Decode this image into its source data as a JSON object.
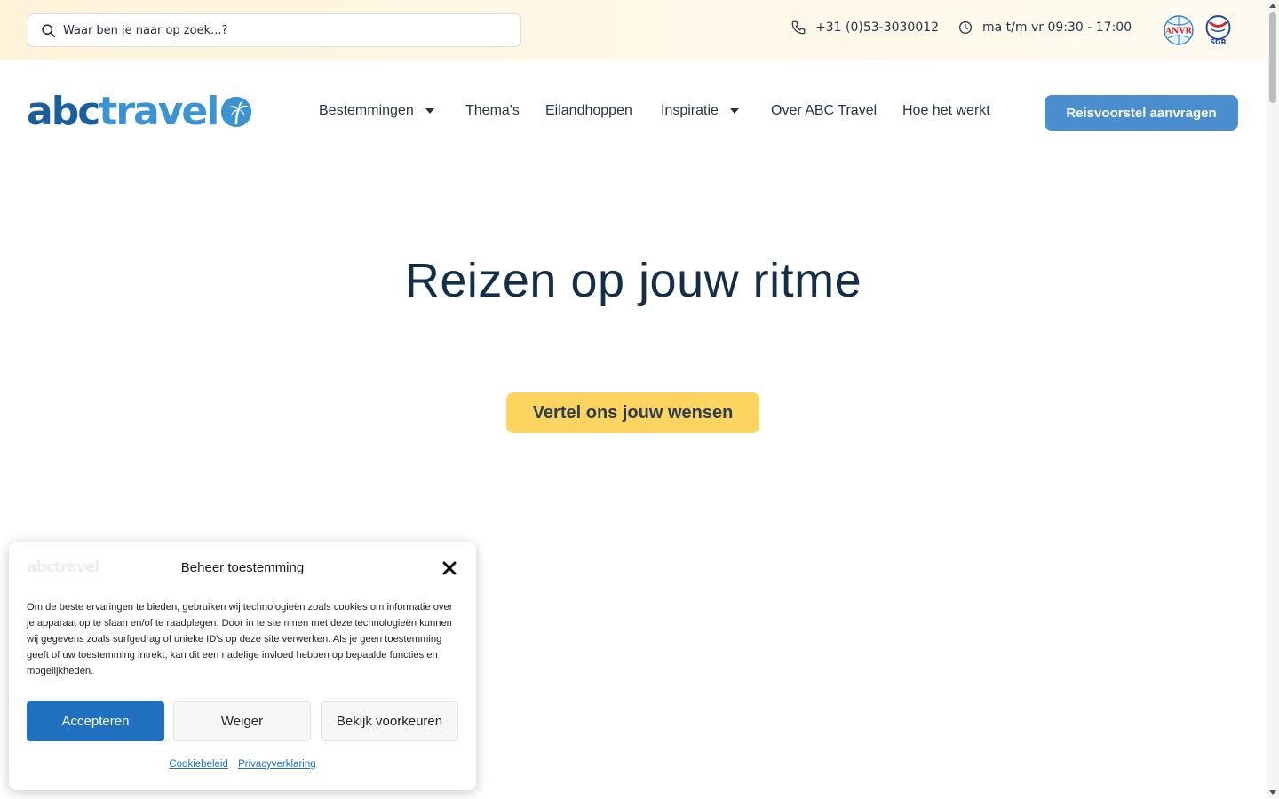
{
  "topbar": {
    "search_placeholder": "Waar ben je naar op zoek...?",
    "phone": "+31 (0)53-3030012",
    "hours": "ma t/m vr 09:30 - 17:00",
    "badge_anvr": "ANVR",
    "badge_sgr": "SGR"
  },
  "logo": {
    "part1": "abc",
    "part2": "travel"
  },
  "nav": {
    "items": [
      {
        "label": "Bestemmingen",
        "dropdown": true
      },
      {
        "label": "Thema's",
        "dropdown": false
      },
      {
        "label": "Eilandhoppen",
        "dropdown": false
      },
      {
        "label": "Inspiratie",
        "dropdown": true
      },
      {
        "label": "Over ABC Travel",
        "dropdown": false
      },
      {
        "label": "Hoe het werkt",
        "dropdown": false
      }
    ],
    "cta": "Reisvoorstel aanvragen"
  },
  "hero": {
    "title": "Reizen op jouw ritme",
    "cta": "Vertel ons jouw wensen"
  },
  "consent": {
    "logo": "abctravel",
    "title": "Beheer toestemming",
    "text": "Om de beste ervaringen te bieden, gebruiken wij technologieën zoals cookies om informatie over je apparaat op te slaan en/of te raadplegen. Door in te stemmen met deze technologieën kunnen wij gegevens zoals surfgedrag of unieke ID's op deze site verwerken. Als je geen toestemming geeft of uw toestemming intrekt, kan dit een nadelige invloed hebben op bepaalde functies en mogelijkheden.",
    "accept": "Accepteren",
    "deny": "Weiger",
    "preferences": "Bekijk voorkeuren",
    "link_cookie": "Cookiebeleid",
    "link_privacy": "Privacyverklaring"
  },
  "colors": {
    "brand_dark": "#1a5f9c",
    "brand_light": "#3b93d3",
    "cta_blue": "#4a8ed0",
    "cta_yellow": "#fdd45f",
    "accept_blue": "#1f71bf"
  }
}
